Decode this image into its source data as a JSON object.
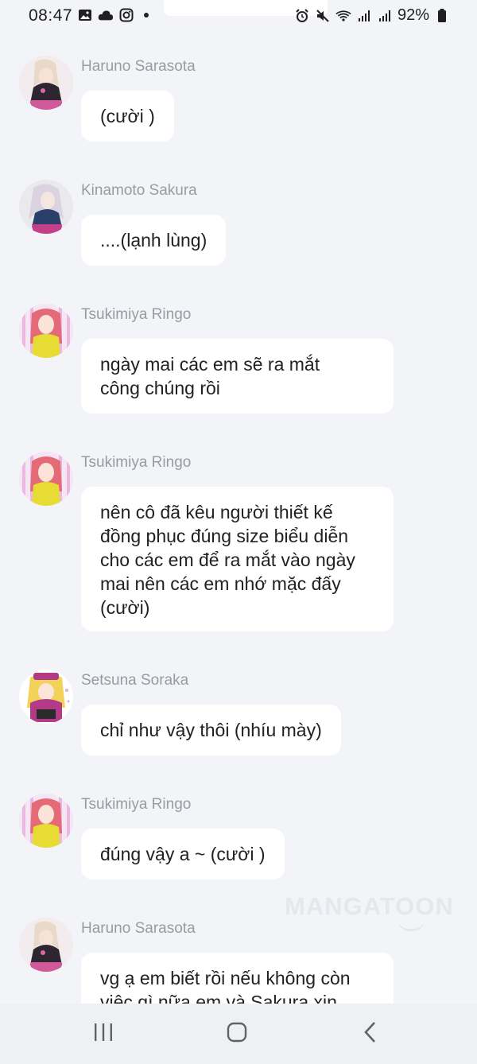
{
  "status_bar": {
    "time": "08:47",
    "battery": "92%",
    "left_icons": [
      "gallery-icon",
      "cloud-icon",
      "instagram-icon",
      "notification-dot"
    ],
    "right_icons": [
      "alarm-icon",
      "mute-icon",
      "wifi-icon",
      "signal-icon",
      "signal-icon",
      "battery-icon"
    ]
  },
  "messages": [
    {
      "sender": "Haruno Sarasota",
      "text": "(cười )",
      "avatar": "haruno-avatar"
    },
    {
      "sender": "Kinamoto Sakura",
      "text": "....(lạnh lùng)",
      "avatar": "sakura-avatar"
    },
    {
      "sender": "Tsukimiya Ringo",
      "lines": [
        "ngày mai các em sẽ ra mắt",
        "công chúng rồi"
      ],
      "avatar": "ringo-avatar"
    },
    {
      "sender": "Tsukimiya Ringo",
      "lines": [
        "nên cô đã kêu người thiết kế",
        "đồng phục đúng size biểu diễn",
        "cho các em để ra mắt vào ngày",
        "mai nên các em nhớ mặc đấy",
        "(cười)"
      ],
      "avatar": "ringo-avatar"
    },
    {
      "sender": "Setsuna Soraka",
      "text": "chỉ như vậy thôi (nhíu mày)",
      "avatar": "soraka-avatar"
    },
    {
      "sender": "Tsukimiya Ringo",
      "text": "đúng vậy a ~ (cười )",
      "avatar": "ringo-avatar"
    },
    {
      "sender": "Haruno Sarasota",
      "lines": [
        "vg ạ em biết rồi nếu không còn",
        "việc gì nữa em và Sakura xin"
      ],
      "avatar": "haruno-avatar"
    }
  ],
  "watermark": "MANGATOON",
  "nav_bar": {
    "buttons": [
      "recent-apps-icon",
      "home-icon",
      "back-icon"
    ]
  },
  "colors": {
    "background": "#f3f4f8",
    "bubble": "#ffffff",
    "name": "#9a9ba2",
    "text": "#202124"
  }
}
